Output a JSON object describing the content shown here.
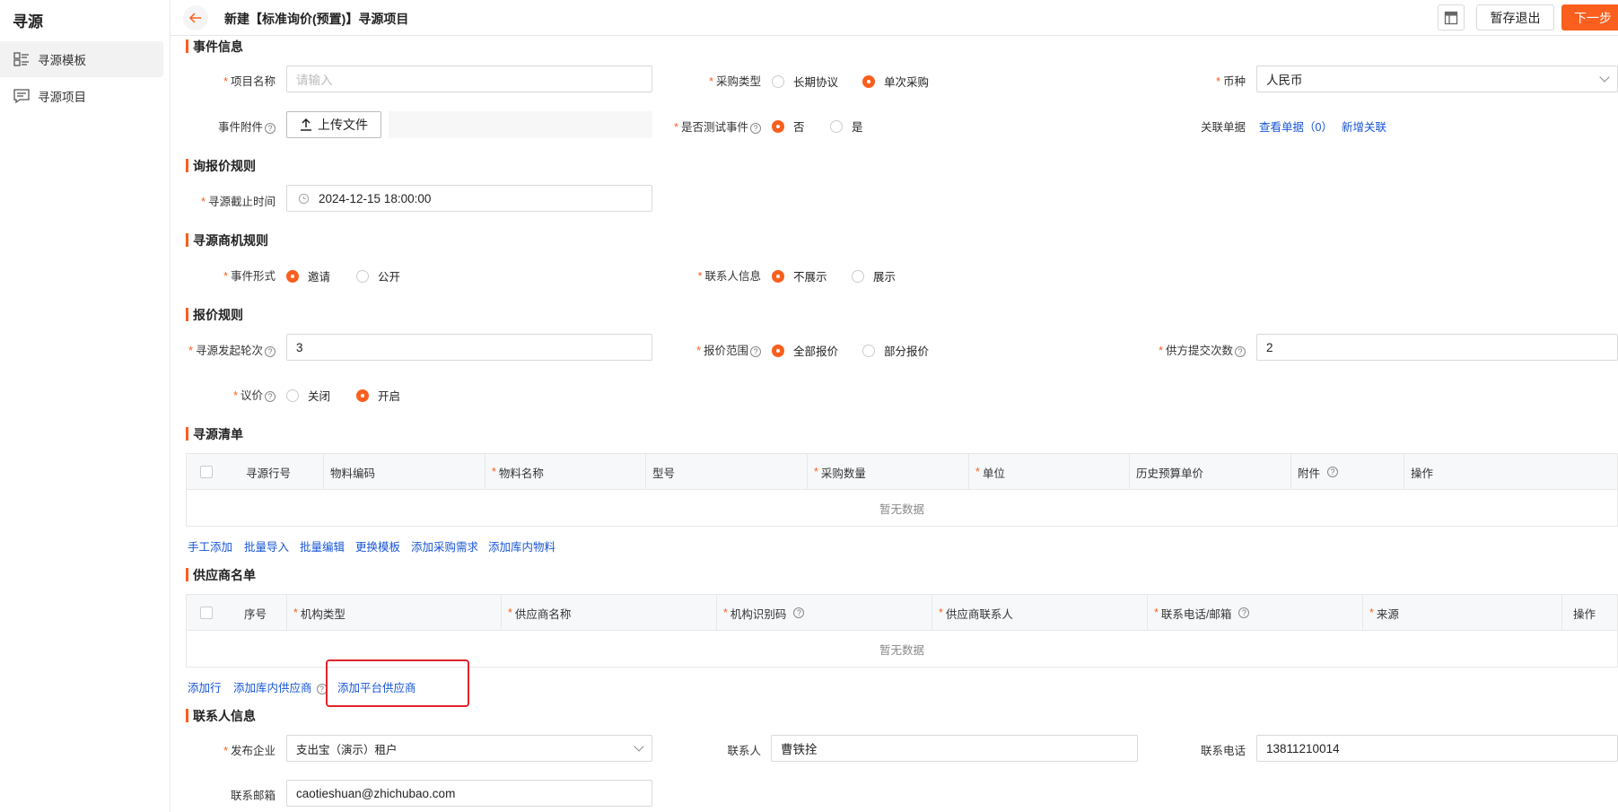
{
  "sidebar": {
    "title": "寻源",
    "items": [
      {
        "label": "寻源模板",
        "icon": "template-list-icon",
        "active": true
      },
      {
        "label": "寻源项目",
        "icon": "message-list-icon",
        "active": false
      }
    ]
  },
  "header": {
    "title": "新建【标准询价(预置)】寻源项目",
    "save_exit": "暂存退出",
    "next": "下一步"
  },
  "event_info": {
    "title": "事件信息",
    "project_name_label": "项目名称",
    "project_name_placeholder": "请输入",
    "purchase_type_label": "采购类型",
    "purchase_type_options": [
      "长期协议",
      "单次采购"
    ],
    "purchase_type_selected": "单次采购",
    "currency_label": "币种",
    "currency_value": "人民币",
    "attachment_label": "事件附件",
    "upload_label": "上传文件",
    "test_event_label": "是否测试事件",
    "test_event_options": [
      "否",
      "是"
    ],
    "test_event_selected": "否",
    "related_doc_label": "关联单据",
    "view_docs_link": "查看单据（0）",
    "add_relation_link": "新增关联"
  },
  "quote_rules": {
    "title": "询报价规则",
    "deadline_label": "寻源截止时间",
    "deadline_value": "2024-12-15 18:00:00"
  },
  "opportunity_rules": {
    "title": "寻源商机规则",
    "event_form_label": "事件形式",
    "event_form_options": [
      "邀请",
      "公开"
    ],
    "event_form_selected": "邀请",
    "contact_info_label": "联系人信息",
    "contact_info_options": [
      "不展示",
      "展示"
    ],
    "contact_info_selected": "不展示"
  },
  "price_rules": {
    "title": "报价规则",
    "rounds_label": "寻源发起轮次",
    "rounds_value": "3",
    "scope_label": "报价范围",
    "scope_options": [
      "全部报价",
      "部分报价"
    ],
    "scope_selected": "全部报价",
    "submit_times_label": "供方提交次数",
    "submit_times_value": "2",
    "negotiate_label": "议价",
    "negotiate_options": [
      "关闭",
      "开启"
    ],
    "negotiate_selected": "开启"
  },
  "sourcing_list": {
    "title": "寻源清单",
    "columns": [
      "寻源行号",
      "物料编码",
      "物料名称",
      "型号",
      "采购数量",
      "单位",
      "历史预算单价",
      "附件",
      "操作"
    ],
    "required_columns": [
      "物料名称",
      "采购数量",
      "单位"
    ],
    "empty_text": "暂无数据",
    "actions": [
      "手工添加",
      "批量导入",
      "批量编辑",
      "更换模板",
      "添加采购需求",
      "添加库内物料"
    ]
  },
  "supplier_list": {
    "title": "供应商名单",
    "columns": [
      "序号",
      "机构类型",
      "供应商名称",
      "机构识别码",
      "供应商联系人",
      "联系电话/邮箱",
      "来源",
      "操作"
    ],
    "required_columns": [
      "机构类型",
      "供应商名称",
      "机构识别码",
      "供应商联系人",
      "联系电话/邮箱",
      "来源"
    ],
    "empty_text": "暂无数据",
    "actions": [
      "添加行",
      "添加库内供应商",
      "添加平台供应商"
    ]
  },
  "contact_info": {
    "title": "联系人信息",
    "company_label": "发布企业",
    "company_value": "支出宝（演示）租户",
    "contact_label": "联系人",
    "contact_value": "曹铁拴",
    "phone_label": "联系电话",
    "phone_value": "13811210014",
    "email_label": "联系邮箱",
    "email_value": "caotieshuan@zhichubao.com"
  },
  "colors": {
    "accent": "#fa5f1e",
    "link": "#1755d6",
    "highlight": "#e0242b"
  }
}
